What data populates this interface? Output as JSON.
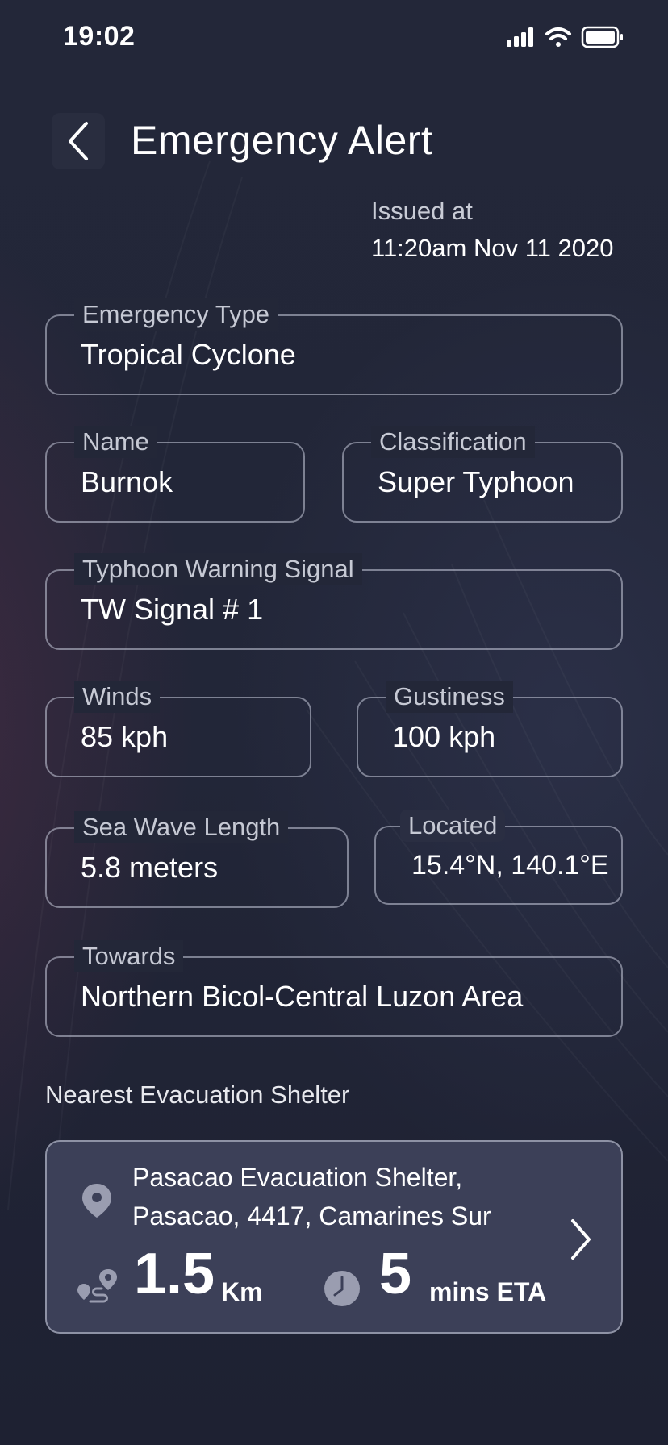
{
  "status_bar": {
    "time": "19:02",
    "icons": [
      "signal-icon",
      "wifi-icon",
      "battery-icon"
    ]
  },
  "header": {
    "title": "Emergency Alert",
    "back_icon": "chevron-left-icon"
  },
  "issued": {
    "label": "Issued at",
    "value": "11:20am Nov 11 2020"
  },
  "fields": {
    "emergency_type": {
      "label": "Emergency Type",
      "value": "Tropical Cyclone"
    },
    "name": {
      "label": "Name",
      "value": "Burnok"
    },
    "classification": {
      "label": "Classification",
      "value": "Super Typhoon"
    },
    "warning_signal": {
      "label": "Typhoon Warning Signal",
      "value": "TW Signal # 1"
    },
    "winds": {
      "label": "Winds",
      "value": "85 kph"
    },
    "gustiness": {
      "label": "Gustiness",
      "value": "100 kph"
    },
    "sea_wave": {
      "label": "Sea Wave Length",
      "value": "5.8 meters"
    },
    "located": {
      "label": "Located",
      "value": "15.4°N, 140.1°E"
    },
    "towards": {
      "label": "Towards",
      "value": "Northern Bicol-Central Luzon Area"
    }
  },
  "shelter": {
    "section_label": "Nearest Evacuation Shelter",
    "name_line1": "Pasacao Evacuation Shelter,",
    "name_line2": "Pasacao, 4417, Camarines Sur",
    "distance_value": "1.5",
    "distance_unit": "Km",
    "eta_value": "5",
    "eta_unit": "mins ETA",
    "icons": [
      "location-pin-icon",
      "route-icon",
      "clock-icon",
      "chevron-right-icon"
    ]
  },
  "colors": {
    "background": "#1f2335",
    "card": "#3c4058",
    "border": "#c8ccdc",
    "label": "#c6c9d4"
  }
}
